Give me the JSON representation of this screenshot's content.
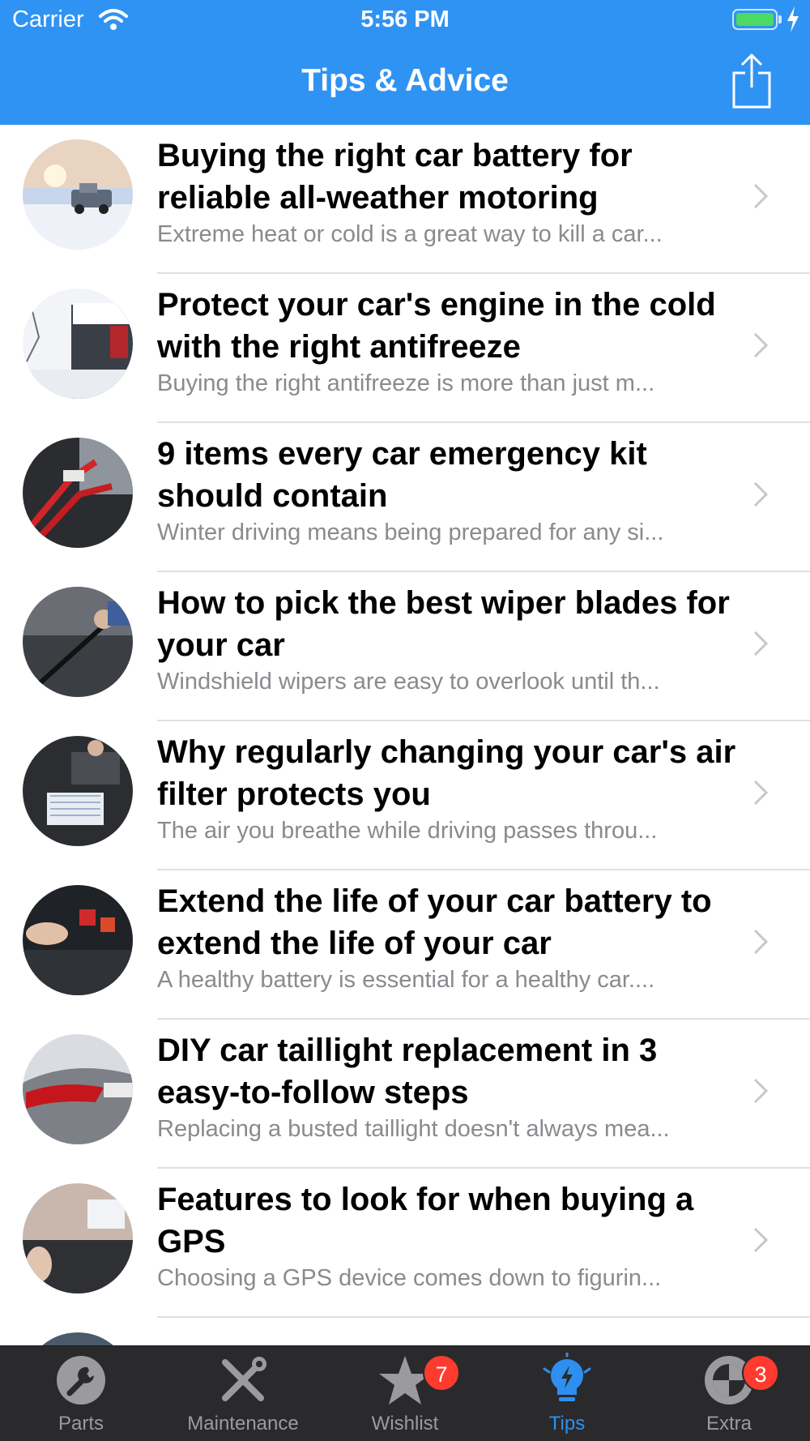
{
  "status_bar": {
    "carrier": "Carrier",
    "time": "5:56 PM"
  },
  "nav": {
    "title": "Tips & Advice",
    "share_icon": "share-icon"
  },
  "articles": [
    {
      "title": "Buying the right car battery for reliable all-weather motoring",
      "snippet": "Extreme heat or cold is a great way to kill a car...",
      "thumbnail": "snowy-pickup-truck-photo"
    },
    {
      "title": "Protect your car's engine in the cold with the right antifreeze",
      "snippet": "Buying the right antifreeze is more than just m...",
      "thumbnail": "snow-covered-car-photo"
    },
    {
      "title": "9 items every car emergency kit should contain",
      "snippet": "Winter driving means being prepared for any si...",
      "thumbnail": "jumper-cables-photo"
    },
    {
      "title": "How to pick the best wiper blades for your car",
      "snippet": "Windshield wipers are easy to overlook until th...",
      "thumbnail": "wiper-blade-photo"
    },
    {
      "title": "Why regularly changing your car's air filter protects you",
      "snippet": "The air you breathe while driving passes throu...",
      "thumbnail": "air-filter-photo"
    },
    {
      "title": "Extend the life of your car battery to extend the life of your car",
      "snippet": "A healthy battery is essential for a healthy car....",
      "thumbnail": "battery-terminal-photo"
    },
    {
      "title": "DIY car taillight replacement in 3 easy-to-follow steps",
      "snippet": "Replacing a busted taillight doesn't always mea...",
      "thumbnail": "taillight-photo"
    },
    {
      "title": "Features to look for when buying a GPS",
      "snippet": "Choosing a GPS device comes down to figurin...",
      "thumbnail": "gps-dashboard-photo"
    },
    {
      "title": "",
      "snippet": "",
      "thumbnail": "partially-visible-photo"
    }
  ],
  "tabs": [
    {
      "label": "Parts",
      "icon": "wrench-icon",
      "badge": "",
      "active": false
    },
    {
      "label": "Maintenance",
      "icon": "tools-icon",
      "badge": "",
      "active": false
    },
    {
      "label": "Wishlist",
      "icon": "star-icon",
      "badge": "7",
      "active": false
    },
    {
      "label": "Tips",
      "icon": "lightbulb-icon",
      "badge": "",
      "active": true
    },
    {
      "label": "Extra",
      "icon": "bmw-logo-icon",
      "badge": "3",
      "active": false
    }
  ],
  "colors": {
    "header_blue": "#2f93f4",
    "tab_active": "#2f8ff0",
    "tab_inactive": "#9b9b9f",
    "badge_red": "#ff3b30",
    "snippet_gray": "#8a8a8f"
  }
}
